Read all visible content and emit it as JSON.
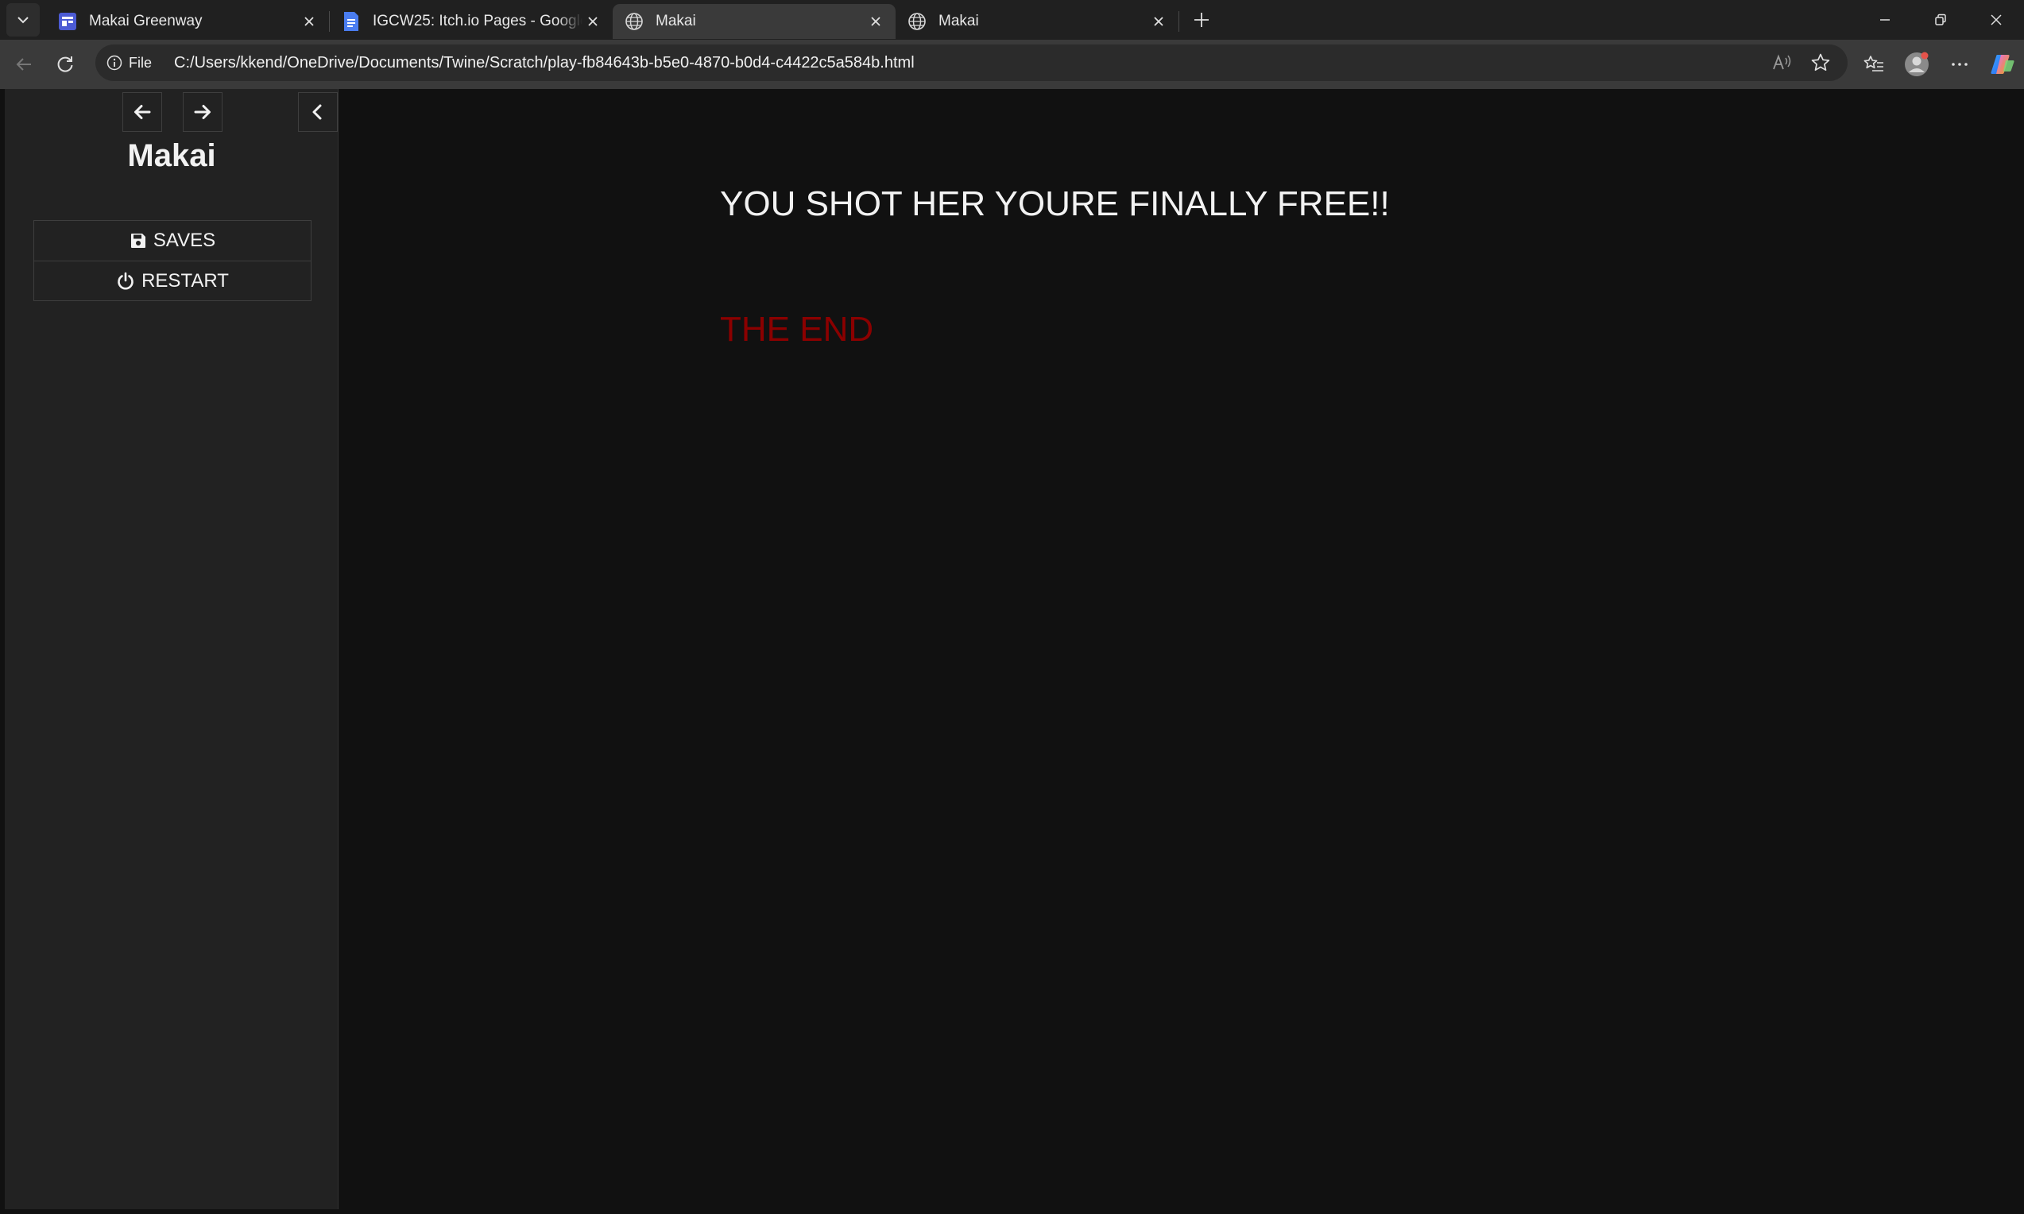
{
  "browser": {
    "tabs": [
      {
        "title": "Makai Greenway",
        "icon": "calendar-app-icon",
        "active": false
      },
      {
        "title": "IGCW25: Itch.io Pages - Google Docs",
        "icon": "google-docs-icon",
        "active": false
      },
      {
        "title": "Makai",
        "icon": "globe-icon",
        "active": true
      },
      {
        "title": "Makai",
        "icon": "globe-icon",
        "active": false
      }
    ],
    "address": {
      "scheme_label": "File",
      "url": "C:/Users/kkend/OneDrive/Documents/Twine/Scratch/play-fb84643b-b5e0-4870-b0d4-c4422c5a584b.html"
    }
  },
  "sidebar": {
    "story_title": "Makai",
    "menu": [
      {
        "label": "SAVES",
        "icon": "floppy-disk-icon"
      },
      {
        "label": "RESTART",
        "icon": "power-icon"
      }
    ]
  },
  "passage": {
    "text": "YOU SHOT HER YOURE FINALLY FREE!!",
    "ending": "THE END",
    "ending_color": "#8b0000"
  }
}
